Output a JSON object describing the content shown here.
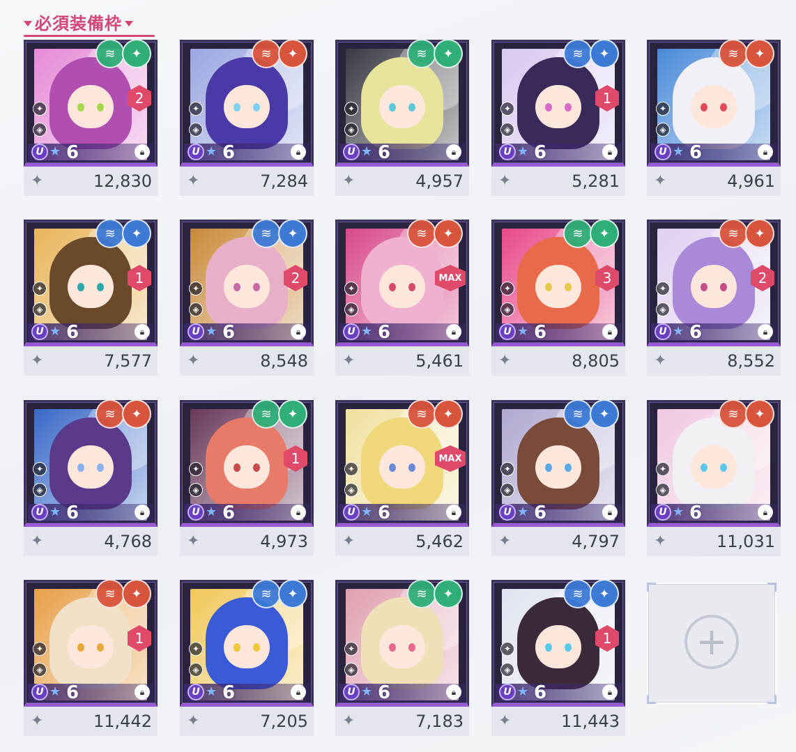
{
  "header": {
    "title": "必須装備枠"
  },
  "icons": {
    "attr_support": "supporter-icon",
    "attr_element": "element-icon",
    "lock": "lock-icon",
    "power": "power-icon",
    "class": "class-icon",
    "add": "plus-icon"
  },
  "colors": {
    "accent": "#d4457a",
    "green": "#2fae78",
    "red": "#d9543c",
    "blue": "#3d7ad6",
    "frame": "#2a2340",
    "rank": "#6a3fc0"
  },
  "cards": [
    {
      "rank": "U",
      "stars": "6",
      "limit_break": "2",
      "power": "12,830",
      "attr1": "green",
      "attr2": "green",
      "hair": "#b04fb0",
      "bg": "#e58ad6",
      "eye": "#a6d64a"
    },
    {
      "rank": "U",
      "stars": "6",
      "limit_break": "",
      "power": "7,284",
      "attr1": "red",
      "attr2": "red",
      "hair": "#4a3aa8",
      "bg": "#9aa6e0",
      "eye": "#7fd0f0"
    },
    {
      "rank": "U",
      "stars": "6",
      "limit_break": "",
      "power": "4,957",
      "attr1": "green",
      "attr2": "green",
      "hair": "#e6e49a",
      "bg": "#3a3a44",
      "eye": "#5cc8d8"
    },
    {
      "rank": "U",
      "stars": "6",
      "limit_break": "1",
      "power": "5,281",
      "attr1": "blue",
      "attr2": "blue",
      "hair": "#3a2a5a",
      "bg": "#d8c8f0",
      "eye": "#d86ac8"
    },
    {
      "rank": "U",
      "stars": "6",
      "limit_break": "",
      "power": "4,961",
      "attr1": "red",
      "attr2": "red",
      "hair": "#f0f0f6",
      "bg": "#4a8ad8",
      "eye": "#e04a5a"
    },
    {
      "rank": "U",
      "stars": "6",
      "limit_break": "1",
      "power": "7,577",
      "attr1": "blue",
      "attr2": "blue",
      "hair": "#6a4a2a",
      "bg": "#e8b45a",
      "eye": "#2aa8a8"
    },
    {
      "rank": "U",
      "stars": "6",
      "limit_break": "2",
      "power": "8,548",
      "attr1": "blue",
      "attr2": "blue",
      "hair": "#e8b0c8",
      "bg": "#c88a3a",
      "eye": "#c86aa8"
    },
    {
      "rank": "U",
      "stars": "6",
      "limit_break": "MAX",
      "power": "5,461",
      "attr1": "red",
      "attr2": "red",
      "hair": "#f0b0d0",
      "bg": "#d84a8a",
      "eye": "#d84a6a"
    },
    {
      "rank": "U",
      "stars": "6",
      "limit_break": "3",
      "power": "8,805",
      "attr1": "green",
      "attr2": "green",
      "hair": "#e86a4a",
      "bg": "#e84a8a",
      "eye": "#e8c84a"
    },
    {
      "rank": "U",
      "stars": "6",
      "limit_break": "2",
      "power": "8,552",
      "attr1": "red",
      "attr2": "red",
      "hair": "#a88ad8",
      "bg": "#e0d0f0",
      "eye": "#c84a8a"
    },
    {
      "rank": "U",
      "stars": "6",
      "limit_break": "",
      "power": "4,768",
      "attr1": "red",
      "attr2": "red",
      "hair": "#5a3a8a",
      "bg": "#3a6ac8",
      "eye": "#8ab0f0"
    },
    {
      "rank": "U",
      "stars": "6",
      "limit_break": "1",
      "power": "4,973",
      "attr1": "green",
      "attr2": "green",
      "hair": "#e87a6a",
      "bg": "#6a3a5a",
      "eye": "#c84a4a"
    },
    {
      "rank": "U",
      "stars": "6",
      "limit_break": "MAX",
      "power": "5,462",
      "attr1": "red",
      "attr2": "red",
      "hair": "#f0d87a",
      "bg": "#f0e0a0",
      "eye": "#6a8ad8"
    },
    {
      "rank": "U",
      "stars": "6",
      "limit_break": "",
      "power": "4,797",
      "attr1": "blue",
      "attr2": "blue",
      "hair": "#7a4a3a",
      "bg": "#b0a8d0",
      "eye": "#5aa8e8"
    },
    {
      "rank": "U",
      "stars": "6",
      "limit_break": "",
      "power": "11,031",
      "attr1": "red",
      "attr2": "red",
      "hair": "#f0f0f4",
      "bg": "#f0c8e0",
      "eye": "#5ac8e8"
    },
    {
      "rank": "U",
      "stars": "6",
      "limit_break": "1",
      "power": "11,442",
      "attr1": "red",
      "attr2": "red",
      "hair": "#f0e0c8",
      "bg": "#e8a04a",
      "eye": "#e8a83a"
    },
    {
      "rank": "U",
      "stars": "6",
      "limit_break": "",
      "power": "7,205",
      "attr1": "blue",
      "attr2": "blue",
      "hair": "#3a5ad8",
      "bg": "#f0c85a",
      "eye": "#f0c83a"
    },
    {
      "rank": "U",
      "stars": "6",
      "limit_break": "",
      "power": "7,183",
      "attr1": "green",
      "attr2": "green",
      "hair": "#f0e0b8",
      "bg": "#e0a0b0",
      "eye": "#e86a8a"
    },
    {
      "rank": "U",
      "stars": "6",
      "limit_break": "1",
      "power": "11,443",
      "attr1": "blue",
      "attr2": "blue",
      "hair": "#3a2a3a",
      "bg": "#e0e4f0",
      "eye": "#5ac8e8"
    }
  ],
  "empty_slot": {
    "icon": "plus-icon"
  }
}
